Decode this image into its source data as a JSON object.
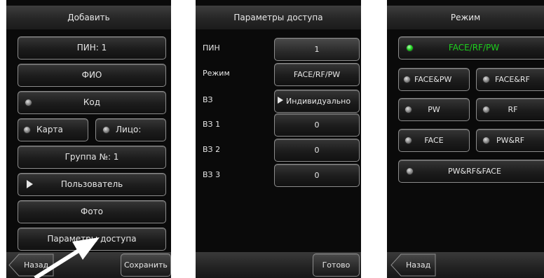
{
  "panel_add": {
    "title": "Добавить",
    "pin": "ПИН: 1",
    "name": "ФИО",
    "code": "Код",
    "card": "Карта",
    "face": "Лицо:",
    "group": "Группа №: 1",
    "user": "Пользователь",
    "photo": "Фото",
    "access": "Параметры доступа",
    "back": "Назад",
    "save": "Сохранить"
  },
  "panel_access": {
    "title": "Параметры доступа",
    "rows": [
      {
        "label": "ПИН",
        "value": "1"
      },
      {
        "label": "Режим",
        "value": "FACE/RF/PW"
      },
      {
        "label": "ВЗ",
        "value": "Индивидуально"
      },
      {
        "label": "ВЗ 1",
        "value": "0"
      },
      {
        "label": "ВЗ 2",
        "value": "0"
      },
      {
        "label": "ВЗ 3",
        "value": "0"
      }
    ],
    "done": "Готово"
  },
  "panel_mode": {
    "title": "Режим",
    "selected": "FACE/RF/PW",
    "options": [
      "FACE&PW",
      "FACE&RF",
      "PW",
      "RF",
      "FACE",
      "PW&RF",
      "PW&RF&FACE"
    ],
    "back": "Назад"
  },
  "colors": {
    "panel_bg": "#0a0a0a",
    "button_border": "#8c8c8c",
    "text": "#e6e6e6",
    "selected_text": "#1ecf1e",
    "arrow": "#ffffff"
  }
}
